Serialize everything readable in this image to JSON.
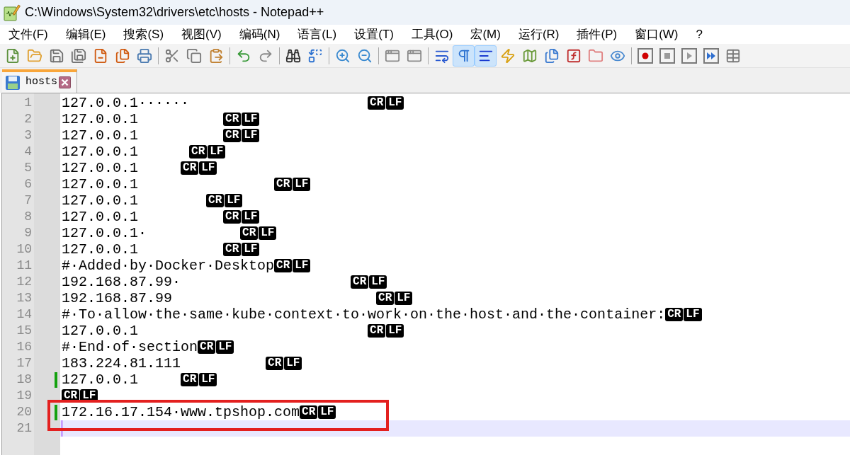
{
  "window": {
    "title": "C:\\Windows\\System32\\drivers\\etc\\hosts - Notepad++"
  },
  "menu": [
    "文件(F)",
    "编辑(E)",
    "搜索(S)",
    "视图(V)",
    "编码(N)",
    "语言(L)",
    "设置(T)",
    "工具(O)",
    "宏(M)",
    "运行(R)",
    "插件(P)",
    "窗口(W)",
    "?"
  ],
  "toolbar": [
    {
      "kind": "button",
      "on": false
    },
    {
      "kind": "button",
      "on": false
    },
    {
      "kind": "button",
      "on": false
    },
    {
      "kind": "button",
      "on": false
    },
    {
      "kind": "button",
      "on": false
    },
    {
      "kind": "button",
      "on": false
    },
    {
      "kind": "button",
      "on": false
    },
    {
      "kind": "separator"
    },
    {
      "kind": "button",
      "on": false
    },
    {
      "kind": "button",
      "on": false
    },
    {
      "kind": "button",
      "on": false
    },
    {
      "kind": "separator"
    },
    {
      "kind": "button",
      "on": false
    },
    {
      "kind": "button",
      "on": false
    },
    {
      "kind": "separator"
    },
    {
      "kind": "button",
      "on": false
    },
    {
      "kind": "button",
      "on": false
    },
    {
      "kind": "separator"
    },
    {
      "kind": "button",
      "on": false
    },
    {
      "kind": "button",
      "on": false
    },
    {
      "kind": "separator"
    },
    {
      "kind": "button",
      "on": false
    },
    {
      "kind": "button",
      "on": false
    },
    {
      "kind": "separator"
    },
    {
      "kind": "button",
      "on": false
    },
    {
      "kind": "button",
      "on": true
    },
    {
      "kind": "button",
      "on": true
    },
    {
      "kind": "button",
      "on": false
    },
    {
      "kind": "button",
      "on": false
    },
    {
      "kind": "button",
      "on": false
    },
    {
      "kind": "button",
      "on": false
    },
    {
      "kind": "button",
      "on": false
    },
    {
      "kind": "button",
      "on": false
    },
    {
      "kind": "separator"
    },
    {
      "kind": "button",
      "on": false
    },
    {
      "kind": "button",
      "on": false
    },
    {
      "kind": "button",
      "on": false
    },
    {
      "kind": "button",
      "on": false
    },
    {
      "kind": "button",
      "on": false
    }
  ],
  "tabs": [
    {
      "label": "hosts",
      "selected": true
    }
  ],
  "editor": {
    "lines": [
      {
        "number": "1",
        "text": "127.0.0.1······",
        "eol": [
          "CR",
          "LF"
        ],
        "changed": false,
        "current": false,
        "annotated": false
      },
      {
        "number": "2",
        "text": "127.0.0.1",
        "eol": [
          "CR",
          "LF"
        ],
        "changed": false,
        "current": false,
        "annotated": false
      },
      {
        "number": "3",
        "text": "127.0.0.1",
        "eol": [
          "CR",
          "LF"
        ],
        "changed": false,
        "current": false,
        "annotated": false
      },
      {
        "number": "4",
        "text": "127.0.0.1",
        "eol": [
          "CR",
          "LF"
        ],
        "changed": false,
        "current": false,
        "annotated": false
      },
      {
        "number": "5",
        "text": "127.0.0.1",
        "eol": [
          "CR",
          "LF"
        ],
        "changed": false,
        "current": false,
        "annotated": false
      },
      {
        "number": "6",
        "text": "127.0.0.1",
        "eol": [
          "CR",
          "LF"
        ],
        "changed": false,
        "current": false,
        "annotated": false
      },
      {
        "number": "7",
        "text": "127.0.0.1",
        "eol": [
          "CR",
          "LF"
        ],
        "changed": false,
        "current": false,
        "annotated": false
      },
      {
        "number": "8",
        "text": "127.0.0.1",
        "eol": [
          "CR",
          "LF"
        ],
        "changed": false,
        "current": false,
        "annotated": false
      },
      {
        "number": "9",
        "text": "127.0.0.1·",
        "eol": [
          "CR",
          "LF"
        ],
        "changed": false,
        "current": false,
        "annotated": false
      },
      {
        "number": "10",
        "text": "127.0.0.1",
        "eol": [
          "CR",
          "LF"
        ],
        "changed": false,
        "current": false,
        "annotated": false
      },
      {
        "number": "11",
        "text": "#·Added·by·Docker·Desktop",
        "eol": [
          "CR",
          "LF"
        ],
        "changed": false,
        "current": false,
        "annotated": false
      },
      {
        "number": "12",
        "text": "192.168.87.99·",
        "eol": [
          "CR",
          "LF"
        ],
        "changed": false,
        "current": false,
        "annotated": false
      },
      {
        "number": "13",
        "text": "192.168.87.99",
        "eol": [
          "CR",
          "LF"
        ],
        "changed": false,
        "current": false,
        "annotated": false
      },
      {
        "number": "14",
        "text": "#·To·allow·the·same·kube·context·to·work·on·the·host·and·the·container:",
        "eol": [
          "CR",
          "LF"
        ],
        "changed": false,
        "current": false,
        "annotated": false
      },
      {
        "number": "15",
        "text": "127.0.0.1",
        "eol": [
          "CR",
          "LF"
        ],
        "changed": false,
        "current": false,
        "annotated": false
      },
      {
        "number": "16",
        "text": "#·End·of·section",
        "eol": [
          "CR",
          "LF"
        ],
        "changed": false,
        "current": false,
        "annotated": false
      },
      {
        "number": "17",
        "text": "183.224.81.111",
        "eol": [
          "CR",
          "LF"
        ],
        "changed": false,
        "current": false,
        "annotated": false
      },
      {
        "number": "18",
        "text": "127.0.0.1",
        "eol": [
          "CR",
          "LF"
        ],
        "changed": true,
        "current": false,
        "annotated": false
      },
      {
        "number": "19",
        "eol": [
          "CR",
          "LF"
        ],
        "changed": false,
        "current": false,
        "annotated": false
      },
      {
        "number": "20",
        "text": "172.16.17.154·www.tpshop.com",
        "eol": [
          "CR",
          "LF"
        ],
        "changed": true,
        "current": false,
        "annotated": true
      },
      {
        "number": "21",
        "changed": false,
        "current": true,
        "annotated": false
      }
    ]
  }
}
